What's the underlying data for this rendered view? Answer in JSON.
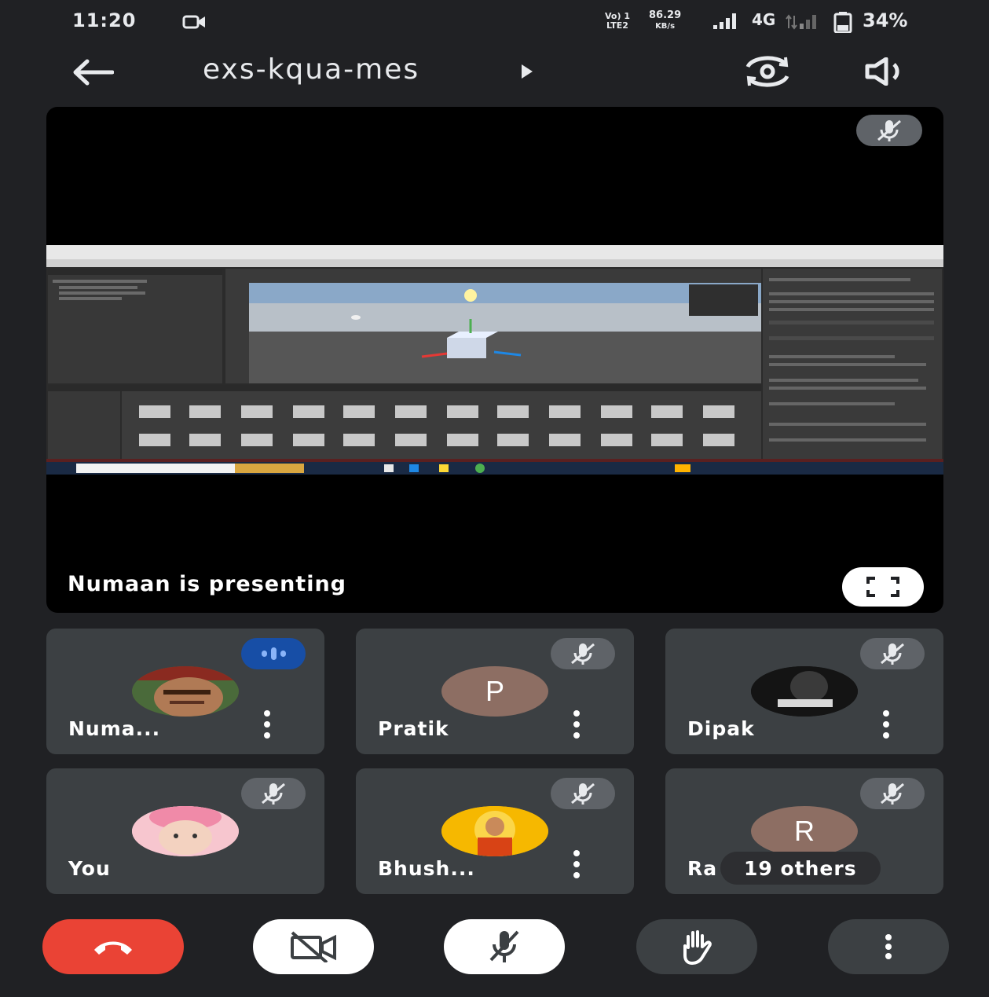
{
  "status_bar": {
    "time": "11:20",
    "volte_top": "Vo) 1",
    "volte_bottom": "LTE2",
    "speed_value": "86.29",
    "speed_unit": "KB/s",
    "network": "4G",
    "battery": "34%",
    "icons": [
      "video-call-icon",
      "signal-icon",
      "signal-icon",
      "battery-icon"
    ]
  },
  "header": {
    "back_icon": "arrow-left-icon",
    "meeting_code": "exs-kqua-mes",
    "switch_camera_icon": "camera-switch-icon",
    "speaker_icon": "speaker-icon"
  },
  "presentation": {
    "label": "Numaan is presenting",
    "mic_icon": "mic-off-icon",
    "fullscreen_icon": "fullscreen-icon"
  },
  "participants": [
    {
      "name": "Numa...",
      "status": "speaking",
      "avatar": "photo"
    },
    {
      "name": "Pratik",
      "status": "muted",
      "avatar_letter": "P",
      "avatar_color": "#8d6e63"
    },
    {
      "name": "Dipak",
      "status": "muted",
      "avatar": "photo"
    },
    {
      "name": "You",
      "status": "muted",
      "avatar": "photo"
    },
    {
      "name": "Bhush...",
      "status": "muted",
      "avatar": "photo"
    },
    {
      "name": "Ra",
      "status": "muted",
      "avatar_letter": "R",
      "avatar_color": "#8d6e63",
      "others": "19 others"
    }
  ],
  "controls": {
    "end_call_icon": "phone-hangup-icon",
    "camera_icon": "camera-off-icon",
    "mic_icon": "mic-off-icon",
    "raise_hand_icon": "raise-hand-icon",
    "more_icon": "more-vert-icon",
    "colors": {
      "end": "#ea4335",
      "toggle": "#ffffff",
      "dark": "#3c4043"
    }
  }
}
